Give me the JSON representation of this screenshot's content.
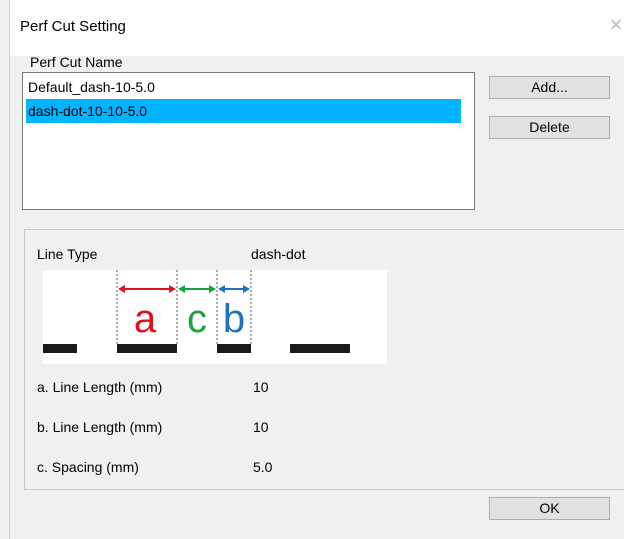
{
  "window": {
    "title": "Perf Cut Setting",
    "close_glyph": "×"
  },
  "list": {
    "label": "Perf Cut Name",
    "items": [
      {
        "label": "Default_dash-10-5.0",
        "selected": false
      },
      {
        "label": "dash-dot-10-10-5.0",
        "selected": true
      }
    ]
  },
  "buttons": {
    "add": "Add...",
    "delete": "Delete",
    "ok": "OK"
  },
  "detail": {
    "line_type_label": "Line Type",
    "line_type_value": "dash-dot",
    "diagram_letters": {
      "a": "a",
      "b": "b",
      "c": "c"
    },
    "fields": [
      {
        "label": "a. Line Length (mm)",
        "value": "10"
      },
      {
        "label": "b. Line Length (mm)",
        "value": "10"
      },
      {
        "label": "c. Spacing (mm)",
        "value": "5.0"
      }
    ]
  },
  "colors": {
    "selection": "#00b4ff",
    "letter_a": "#e0101e",
    "letter_b": "#1c73c4",
    "letter_c": "#19a23e"
  }
}
